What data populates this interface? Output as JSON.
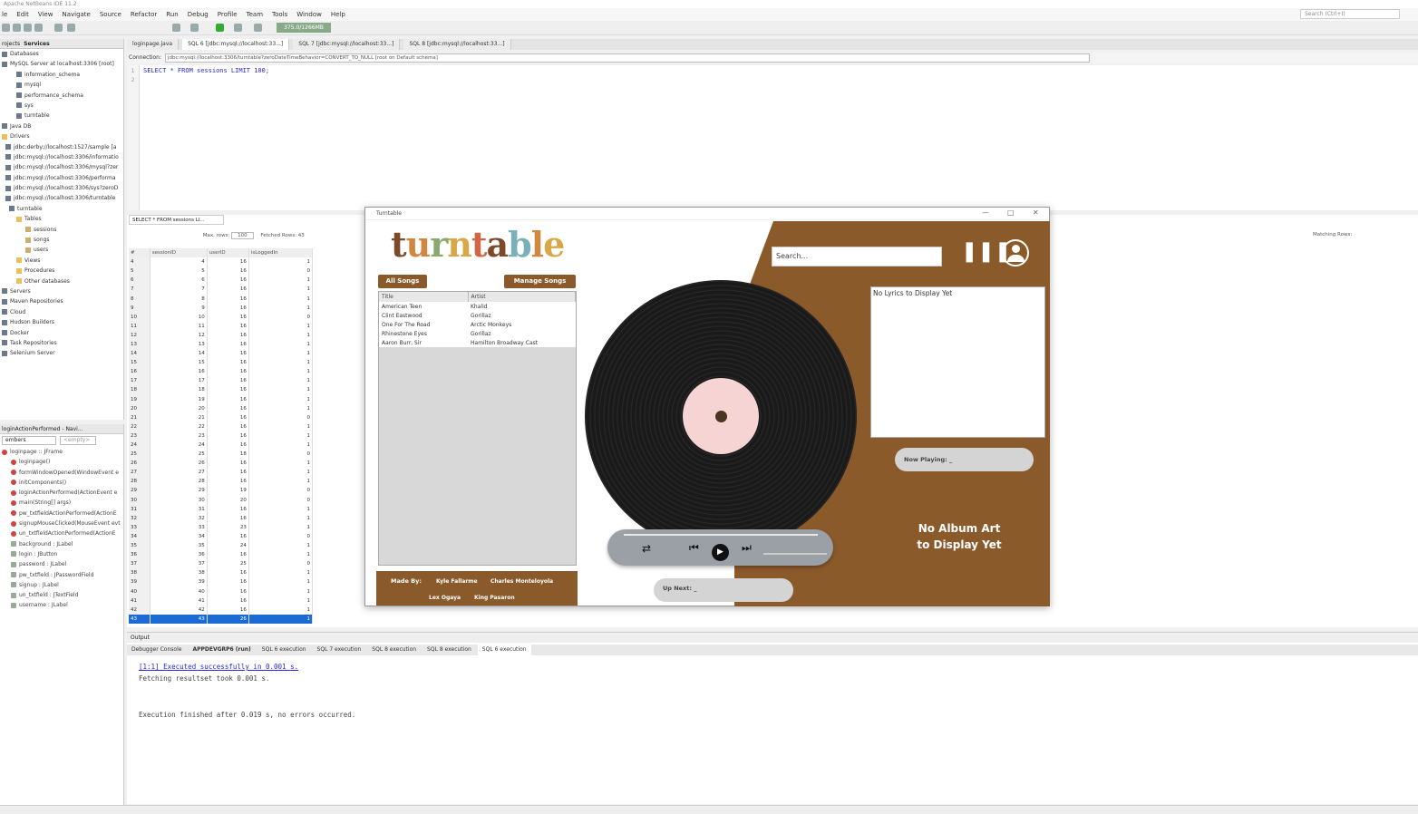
{
  "window": {
    "title": "Apache NetBeans IDE 11.2"
  },
  "menu": [
    "le",
    "Edit",
    "View",
    "Navigate",
    "Source",
    "Refactor",
    "Run",
    "Debug",
    "Profile",
    "Team",
    "Tools",
    "Window",
    "Help"
  ],
  "search": {
    "placeholder": "Search (Ctrl+I)"
  },
  "memory": "375.0/1266MB",
  "left_tabs": [
    "rojects",
    "Services"
  ],
  "tree": [
    {
      "label": "Databases",
      "icon": "db"
    },
    {
      "label": "MySQL Server at localhost:3306 [root]",
      "icon": "db"
    },
    {
      "label": "information_schema",
      "icon": "db"
    },
    {
      "label": "mysql",
      "icon": "db"
    },
    {
      "label": "performance_schema",
      "icon": "db"
    },
    {
      "label": "sys",
      "icon": "db"
    },
    {
      "label": "turntable",
      "icon": "db"
    },
    {
      "label": "Java DB",
      "icon": "db"
    },
    {
      "label": "Drivers",
      "icon": "fold"
    },
    {
      "label": "jdbc:derby://localhost:1527/sample [a",
      "icon": "db"
    },
    {
      "label": "jdbc:mysql://localhost:3306/informatio",
      "icon": "db"
    },
    {
      "label": "jdbc:mysql://localhost:3306/mysql?zer",
      "icon": "db"
    },
    {
      "label": "jdbc:mysql://localhost:3306/performa",
      "icon": "db"
    },
    {
      "label": "jdbc:mysql://localhost:3306/sys?zeroD",
      "icon": "db"
    },
    {
      "label": "jdbc:mysql://localhost:3306/turntable",
      "icon": "db"
    },
    {
      "label": "turntable",
      "icon": "db"
    },
    {
      "label": "Tables",
      "icon": "fold"
    },
    {
      "label": "sessions",
      "icon": "tbl"
    },
    {
      "label": "songs",
      "icon": "tbl"
    },
    {
      "label": "users",
      "icon": "tbl"
    },
    {
      "label": "Views",
      "icon": "fold"
    },
    {
      "label": "Procedures",
      "icon": "fold"
    },
    {
      "label": "Other databases",
      "icon": "fold"
    },
    {
      "label": "Servers",
      "icon": "db"
    },
    {
      "label": "Maven Repositories",
      "icon": "db"
    },
    {
      "label": "Cloud",
      "icon": "db"
    },
    {
      "label": "Hudson Builders",
      "icon": "db"
    },
    {
      "label": "Docker",
      "icon": "db"
    },
    {
      "label": "Task Repositories",
      "icon": "db"
    },
    {
      "label": "Selenium Server",
      "icon": "db"
    }
  ],
  "nav": {
    "title": "loginActionPerformed - Navi...",
    "filter": "embers",
    "filter2": "<empty>",
    "items": [
      "loginpage :: JFrame",
      "loginpage()",
      "formWindowOpened(WindowEvent e",
      "initComponents()",
      "loginActionPerformed(ActionEvent e",
      "main(String[] args)",
      "pw_txtfieldActionPerformed(ActionE",
      "signupMouseClicked(MouseEvent evt",
      "un_txtfieldActionPerformed(ActionE",
      "background : JLabel",
      "login : JButton",
      "password : JLabel",
      "pw_txtfield : JPasswordField",
      "signup : JLabel",
      "un_txtfield : JTextField",
      "username : JLabel"
    ]
  },
  "editor_tabs": [
    "loginpage.java",
    "SQL 6 [jdbc:mysql://localhost:33...]",
    "SQL 7 [jdbc:mysql://localhost:33...]",
    "SQL 8 [jdbc:mysql://localhost:33...]"
  ],
  "connection": {
    "label": "Connection:",
    "value": "jdbc:mysql://localhost:3306/turntable?zeroDateTimeBehavior=CONVERT_TO_NULL [root on Default schema]"
  },
  "sql": {
    "line1": "SELECT * FROM sessions LIMIT 100;",
    "lines": [
      "1",
      "2"
    ]
  },
  "results": {
    "tab": "SELECT * FROM sessions LI...",
    "maxrows_label": "Max. rows:",
    "maxrows": "100",
    "fetched": "Fetched Rows: 43",
    "matching": "Matching Rows:",
    "columns": [
      "#",
      "sessionID",
      "userID",
      "isLoggedIn"
    ],
    "rows": [
      [
        "4",
        "4",
        "16",
        "1"
      ],
      [
        "5",
        "5",
        "16",
        "0"
      ],
      [
        "6",
        "6",
        "16",
        "1"
      ],
      [
        "7",
        "7",
        "16",
        "1"
      ],
      [
        "8",
        "8",
        "16",
        "1"
      ],
      [
        "9",
        "9",
        "16",
        "1"
      ],
      [
        "10",
        "10",
        "16",
        "0"
      ],
      [
        "11",
        "11",
        "16",
        "1"
      ],
      [
        "12",
        "12",
        "16",
        "1"
      ],
      [
        "13",
        "13",
        "16",
        "1"
      ],
      [
        "14",
        "14",
        "16",
        "1"
      ],
      [
        "15",
        "15",
        "16",
        "1"
      ],
      [
        "16",
        "16",
        "16",
        "1"
      ],
      [
        "17",
        "17",
        "16",
        "1"
      ],
      [
        "18",
        "18",
        "16",
        "1"
      ],
      [
        "19",
        "19",
        "16",
        "1"
      ],
      [
        "20",
        "20",
        "16",
        "1"
      ],
      [
        "21",
        "21",
        "16",
        "0"
      ],
      [
        "22",
        "22",
        "16",
        "1"
      ],
      [
        "23",
        "23",
        "16",
        "1"
      ],
      [
        "24",
        "24",
        "16",
        "1"
      ],
      [
        "25",
        "25",
        "18",
        "0"
      ],
      [
        "26",
        "26",
        "16",
        "1"
      ],
      [
        "27",
        "27",
        "16",
        "1"
      ],
      [
        "28",
        "28",
        "16",
        "1"
      ],
      [
        "29",
        "29",
        "19",
        "0"
      ],
      [
        "30",
        "30",
        "20",
        "0"
      ],
      [
        "31",
        "31",
        "16",
        "1"
      ],
      [
        "32",
        "32",
        "16",
        "1"
      ],
      [
        "33",
        "33",
        "23",
        "1"
      ],
      [
        "34",
        "34",
        "16",
        "0"
      ],
      [
        "35",
        "35",
        "24",
        "1"
      ],
      [
        "36",
        "36",
        "16",
        "1"
      ],
      [
        "37",
        "37",
        "25",
        "0"
      ],
      [
        "38",
        "38",
        "16",
        "1"
      ],
      [
        "39",
        "39",
        "16",
        "1"
      ],
      [
        "40",
        "40",
        "16",
        "1"
      ],
      [
        "41",
        "41",
        "16",
        "1"
      ],
      [
        "42",
        "42",
        "16",
        "1"
      ],
      [
        "43",
        "43",
        "26",
        "1"
      ]
    ]
  },
  "output": {
    "title": "Output",
    "tabs": [
      "Debugger Console",
      "APPDEVGRP6 (run)",
      "SQL 6 execution",
      "SQL 7 execution",
      "SQL 8 execution",
      "SQL 8 execution",
      "SQL 6 execution"
    ],
    "line1": "[1:1] Executed successfully in 0.001 s.",
    "line2": "Fetching resultset took 0.001 s.",
    "line3": "Execution finished after 0.019 s, no errors occurred."
  },
  "turntable": {
    "title": "Turntable",
    "logo": "turntable",
    "all_songs": "All Songs",
    "manage_songs": "Manage Songs",
    "columns": [
      "Title",
      "Artist"
    ],
    "songs": [
      [
        "American Teen",
        "Khalid"
      ],
      [
        "Clint Eastwood",
        "Gorillaz"
      ],
      [
        "One For The Road",
        "Arctic Monkeys"
      ],
      [
        "Rhinestone Eyes",
        "Gorillaz"
      ],
      [
        "Aaron Burr, Sir",
        "Hamilton Broadway Cast"
      ]
    ],
    "made_by": "Made By:",
    "authors": [
      "Kyle Fallarme",
      "Charles Monteloyola",
      "Lex Ogaya",
      "King Pasaron"
    ],
    "search_placeholder": "Search...",
    "lyrics": "No Lyrics to Display Yet",
    "now_playing": "Now Playing: _",
    "up_next": "Up Next: _",
    "no_art_1": "No Album Art",
    "no_art_2": "to Display Yet",
    "brand_brown": "#8b5a2b"
  }
}
